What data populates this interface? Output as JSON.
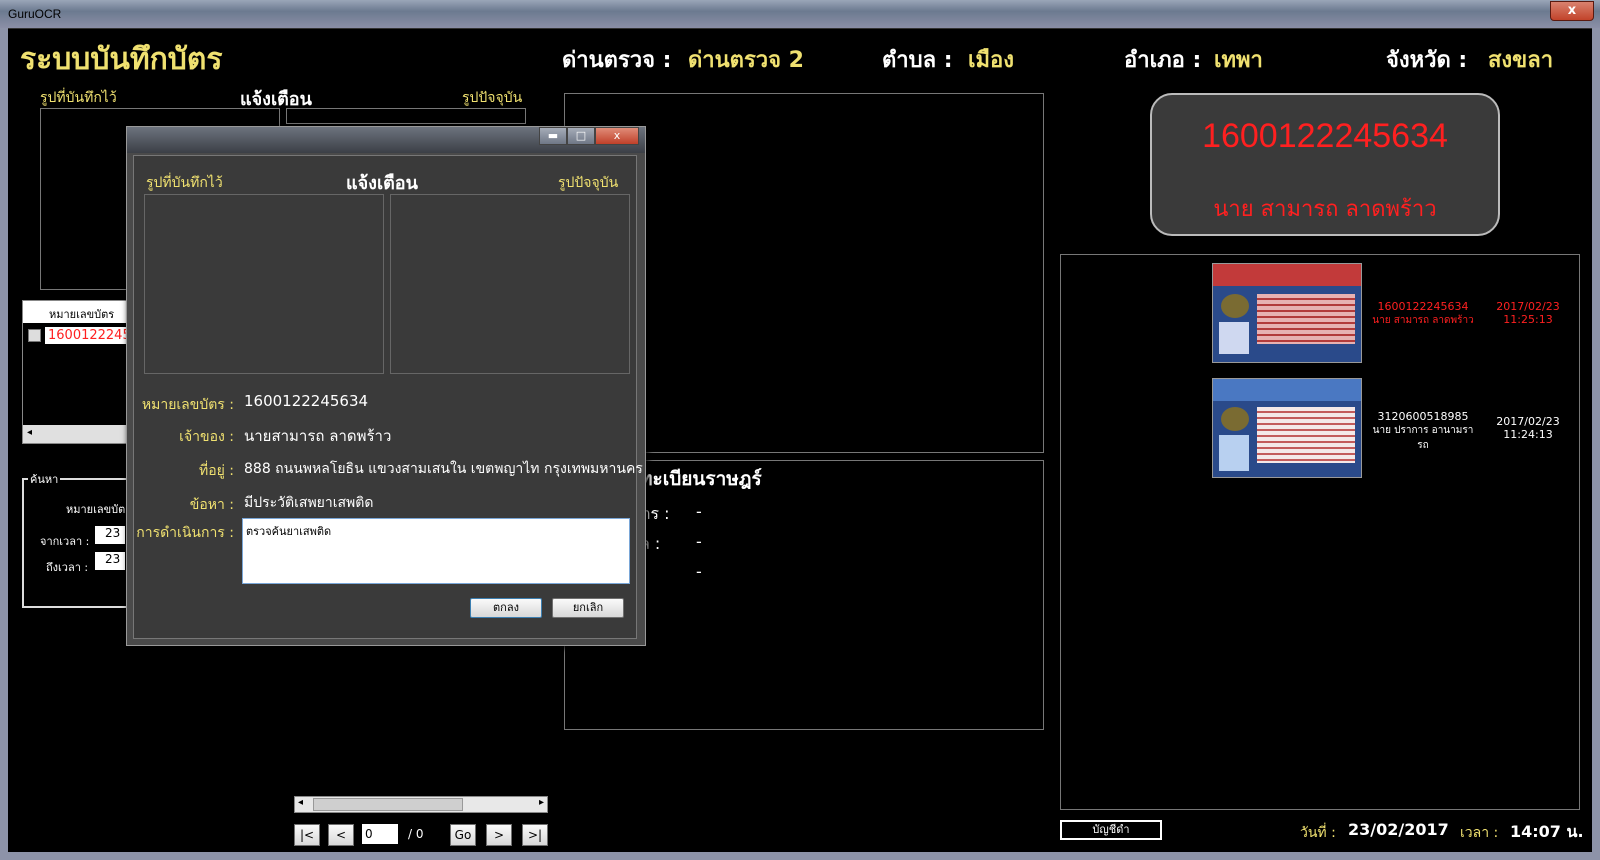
{
  "window": {
    "title": "GuruOCR",
    "close": "x"
  },
  "header": {
    "app_title": "ระบบบันทึกบัตร",
    "checkpoint_label": "ด่านตรวจ :",
    "checkpoint_value": "ด่านตรวจ 2",
    "subdistrict_label": "ตำบล :",
    "subdistrict_value": "เมือง",
    "district_label": "อำเภอ :",
    "district_value": "เทพา",
    "province_label": "จังหวัด :",
    "province_value": "สงขลา"
  },
  "alert_panel": {
    "saved_photo": "รูปที่บันทึกไว้",
    "title": "แจ้งเตือน",
    "current_photo": "รูปปัจจุบัน"
  },
  "list": {
    "column": "หมายเลขบัตร",
    "row0": "16001222456"
  },
  "search": {
    "group": "ค้นหา",
    "card_no": "หมายเลขบัต",
    "from_time": "จากเวลา :",
    "to_time": "ถึงเวลา :",
    "from_val": "23",
    "to_val": "23"
  },
  "registry": {
    "title": "ทะเบียนราษฎร์",
    "row1_lbl": "ัตร :",
    "row1_val": "-",
    "row2_lbl": "ล :",
    "row2_val": "-",
    "row3_val": "-"
  },
  "info": {
    "id": "1600122245634",
    "name": "นาย สามารถ ลาดพร้าว"
  },
  "records": [
    {
      "id": "1600122245634",
      "name": "นาย สามารถ ลาดพร้าว",
      "date": "2017/02/23",
      "time": "11:25:13",
      "color": "#ff2020"
    },
    {
      "id": "3120600518985",
      "name": "นาย ปราการ อานามรา",
      "name2": "รถ",
      "date": "2017/02/23",
      "time": "11:24:13",
      "color": "#ffffff"
    }
  ],
  "dialog": {
    "min": "▬",
    "max": "□",
    "close": "x",
    "saved_photo": "รูปที่บันทึกไว้",
    "title": "แจ้งเตือน",
    "current_photo": "รูปปัจจุบัน",
    "card_lbl": "หมายเลขบัตร :",
    "card_val": "1600122245634",
    "owner_lbl": "เจ้าของ :",
    "owner_val": "นายสามารถ ลาดพร้าว",
    "addr_lbl": "ที่อยู่ :",
    "addr_val": "888 ถนนพหลโยธิน แขวงสามเสนใน เขตพญาไท กรุงเทพมหานคร",
    "charge_lbl": "ข้อหา :",
    "charge_val": "มีประวัติเสพยาเสพติด",
    "action_lbl": "การดำเนินการ :",
    "action_val": "ตรวจค้นยาเสพติด",
    "ok": "ตกลง",
    "cancel": "ยกเลิก"
  },
  "pager": {
    "first": "|<",
    "prev": "<",
    "page": "0",
    "total": "/ 0",
    "go": "Go",
    "next": ">",
    "last": ">|"
  },
  "footer": {
    "account_btn": "บัญชีดำ",
    "date_lbl": "วันที่ :",
    "date_val": "23/02/2017",
    "time_lbl": "เวลา :",
    "time_val": "14:07 น."
  }
}
